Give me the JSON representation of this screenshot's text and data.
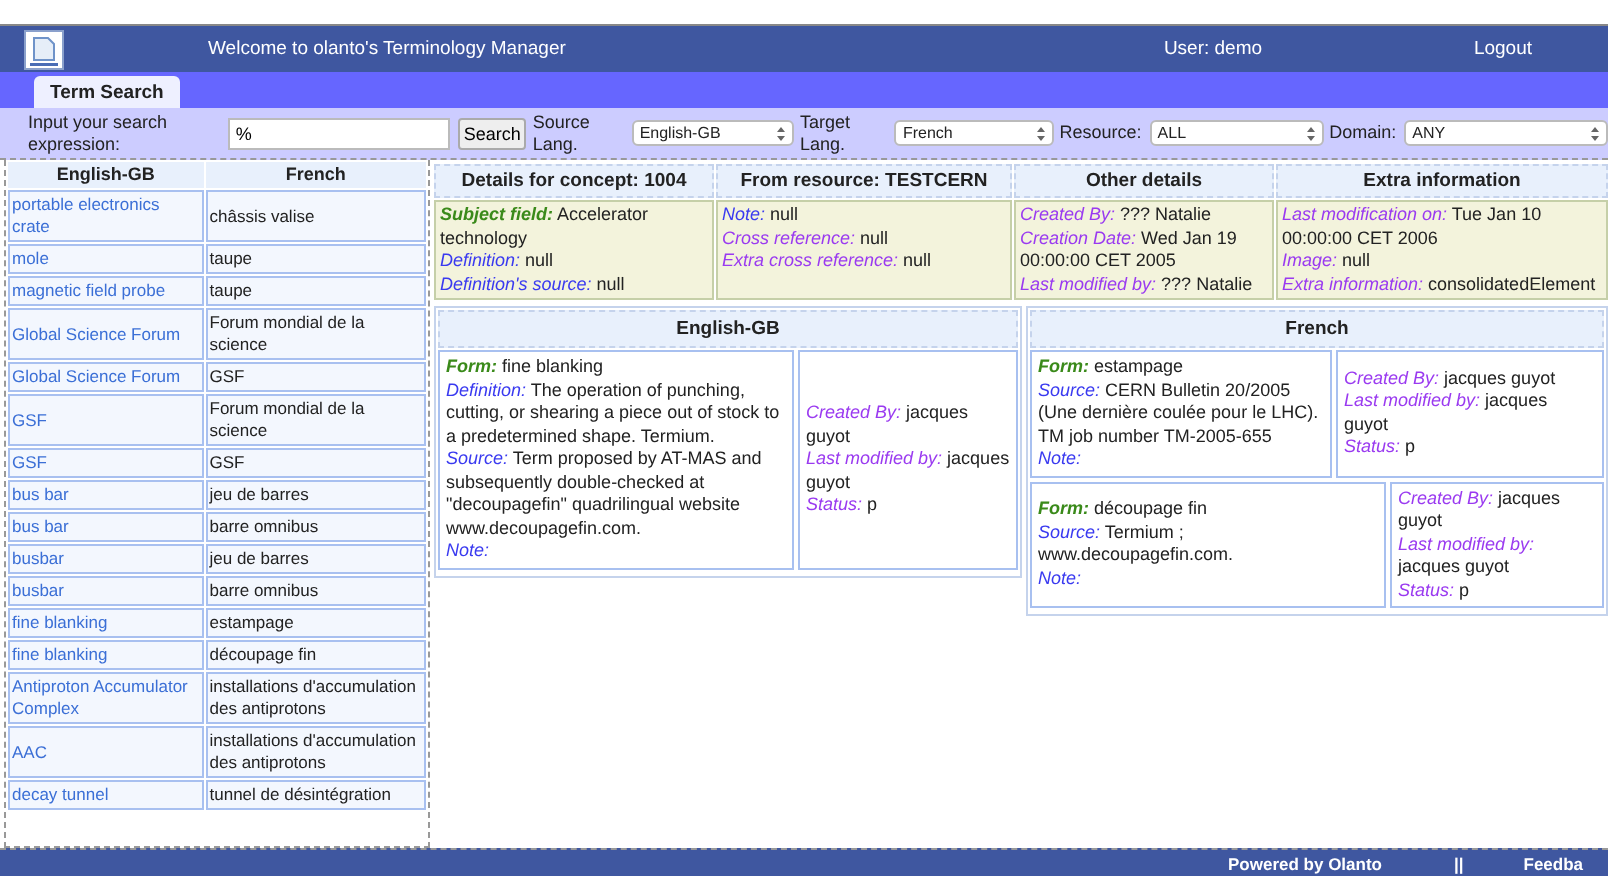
{
  "header": {
    "title": "Welcome to olanto's Terminology Manager",
    "user": "User: demo",
    "logout": "Logout"
  },
  "tabs": [
    {
      "label": "Term Search",
      "selected": true
    }
  ],
  "search": {
    "label": "Input your search expression:",
    "value": "%",
    "button": "Search",
    "filters": [
      {
        "label": "Source Lang.",
        "value": "English-GB"
      },
      {
        "label": "Target Lang.",
        "value": "French"
      },
      {
        "label": "Resource:",
        "value": "ALL"
      },
      {
        "label": "Domain:",
        "value": "ANY"
      }
    ]
  },
  "results": {
    "columns": [
      "English-GB",
      "French"
    ],
    "rows": [
      [
        "portable electronics crate",
        "châssis valise"
      ],
      [
        "mole",
        "taupe"
      ],
      [
        "magnetic field probe",
        "taupe"
      ],
      [
        "Global Science Forum",
        "Forum mondial de la science"
      ],
      [
        "Global Science Forum",
        "GSF"
      ],
      [
        "GSF",
        "Forum mondial de la science"
      ],
      [
        "GSF",
        "GSF"
      ],
      [
        "bus bar",
        "jeu de barres"
      ],
      [
        "bus bar",
        "barre omnibus"
      ],
      [
        "busbar",
        "jeu de barres"
      ],
      [
        "busbar",
        "barre omnibus"
      ],
      [
        "fine blanking",
        "estampage"
      ],
      [
        "fine blanking",
        "découpage fin"
      ],
      [
        "Antiproton Accumulator Complex",
        "installations d'accumulation des antiprotons"
      ],
      [
        "AAC",
        "installations d'accumulation des antiprotons"
      ],
      [
        "decay tunnel",
        "tunnel de désintégration"
      ]
    ]
  },
  "concept": {
    "sections": [
      {
        "title": "Details for concept: 1004",
        "fields": [
          {
            "kind": "subject",
            "label": "Subject field:",
            "value": "Accelerator technology"
          },
          {
            "kind": "core",
            "label": "Definition:",
            "value": "null"
          },
          {
            "kind": "core",
            "label": "Definition's source:",
            "value": "null"
          }
        ]
      },
      {
        "title": "From resource: TESTCERN",
        "fields": [
          {
            "kind": "core",
            "label": "Note:",
            "value": "null"
          },
          {
            "kind": "meta",
            "label": "Cross reference:",
            "value": "null"
          },
          {
            "kind": "meta",
            "label": "Extra cross reference:",
            "value": "null"
          }
        ]
      },
      {
        "title": "Other details",
        "fields": [
          {
            "kind": "meta",
            "label": "Created By:",
            "value": "??? Natalie"
          },
          {
            "kind": "meta",
            "label": "Creation Date:",
            "value": "Wed Jan 19 00:00:00 CET 2005"
          },
          {
            "kind": "meta",
            "label": "Last modified by:",
            "value": "??? Natalie"
          }
        ]
      },
      {
        "title": "Extra information",
        "fields": [
          {
            "kind": "meta",
            "label": "Last modification on:",
            "value": "Tue Jan 10 00:00:00 CET 2006"
          },
          {
            "kind": "meta",
            "label": "Image:",
            "value": "null"
          },
          {
            "kind": "meta",
            "label": "Extra information:",
            "value": "consolidatedElement"
          }
        ]
      }
    ]
  },
  "languages": [
    {
      "title": "English-GB",
      "terms": [
        {
          "main": [
            {
              "kind": "subject",
              "label": "Form:",
              "value": "fine blanking"
            },
            {
              "kind": "core",
              "label": "Definition:",
              "value": "The operation of punching, cutting, or shearing a piece out of stock to a predetermined shape. Termium."
            },
            {
              "kind": "core",
              "label": "Source:",
              "value": "Term proposed by AT-MAS and subsequently double-checked at \"decoupagefin\" quadrilingual website www.decoupagefin.com."
            },
            {
              "kind": "core",
              "label": "Note:"
            }
          ],
          "meta": [
            {
              "kind": "meta",
              "label": "Created By:",
              "value": "jacques guyot"
            },
            {
              "kind": "meta",
              "label": "Last modified by:",
              "value": "jacques guyot"
            },
            {
              "kind": "meta",
              "label": "Status:",
              "value": "p"
            }
          ]
        }
      ]
    },
    {
      "title": "French",
      "terms": [
        {
          "main": [
            {
              "kind": "subject",
              "label": "Form:",
              "value": "estampage"
            },
            {
              "kind": "core",
              "label": "Source:",
              "value": "CERN Bulletin 20/2005 (Une dernière coulée pour le LHC). TM job number TM-2005-655"
            },
            {
              "kind": "core",
              "label": "Note:"
            }
          ],
          "meta": [
            {
              "kind": "meta",
              "label": "Created By:",
              "value": "jacques guyot"
            },
            {
              "kind": "meta",
              "label": "Last modified by:",
              "value": "jacques guyot"
            },
            {
              "kind": "meta",
              "label": "Status:",
              "value": "p"
            }
          ]
        },
        {
          "main": [
            {
              "kind": "subject",
              "label": "Form:",
              "value": "découpage fin"
            },
            {
              "kind": "core",
              "label": "Source:",
              "value": "Termium ; www.decoupagefin.com."
            },
            {
              "kind": "core",
              "label": "Note:"
            }
          ],
          "meta": [
            {
              "kind": "meta",
              "label": "Created By:",
              "value": "jacques guyot"
            },
            {
              "kind": "meta",
              "label": "Last modified by:",
              "value": "jacques guyot"
            },
            {
              "kind": "meta",
              "label": "Status:",
              "value": "p"
            }
          ]
        }
      ]
    }
  ],
  "footer": {
    "powered": "Powered by Olanto",
    "separator": "||",
    "feedback": "Feedba"
  }
}
